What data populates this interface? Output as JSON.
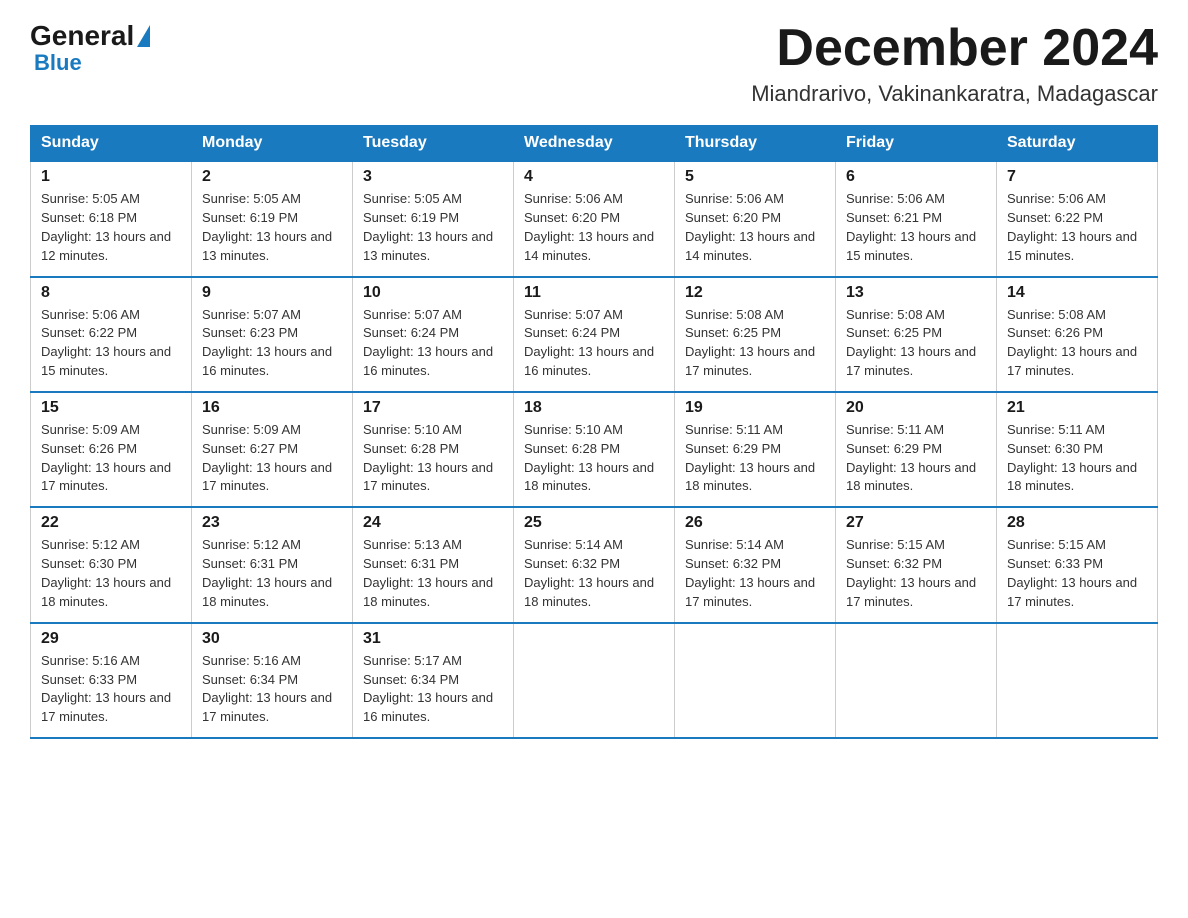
{
  "logo": {
    "general": "General",
    "blue": "Blue"
  },
  "title": "December 2024",
  "location": "Miandrarivo, Vakinankaratra, Madagascar",
  "days_of_week": [
    "Sunday",
    "Monday",
    "Tuesday",
    "Wednesday",
    "Thursday",
    "Friday",
    "Saturday"
  ],
  "weeks": [
    [
      {
        "day": "1",
        "sunrise": "Sunrise: 5:05 AM",
        "sunset": "Sunset: 6:18 PM",
        "daylight": "Daylight: 13 hours and 12 minutes."
      },
      {
        "day": "2",
        "sunrise": "Sunrise: 5:05 AM",
        "sunset": "Sunset: 6:19 PM",
        "daylight": "Daylight: 13 hours and 13 minutes."
      },
      {
        "day": "3",
        "sunrise": "Sunrise: 5:05 AM",
        "sunset": "Sunset: 6:19 PM",
        "daylight": "Daylight: 13 hours and 13 minutes."
      },
      {
        "day": "4",
        "sunrise": "Sunrise: 5:06 AM",
        "sunset": "Sunset: 6:20 PM",
        "daylight": "Daylight: 13 hours and 14 minutes."
      },
      {
        "day": "5",
        "sunrise": "Sunrise: 5:06 AM",
        "sunset": "Sunset: 6:20 PM",
        "daylight": "Daylight: 13 hours and 14 minutes."
      },
      {
        "day": "6",
        "sunrise": "Sunrise: 5:06 AM",
        "sunset": "Sunset: 6:21 PM",
        "daylight": "Daylight: 13 hours and 15 minutes."
      },
      {
        "day": "7",
        "sunrise": "Sunrise: 5:06 AM",
        "sunset": "Sunset: 6:22 PM",
        "daylight": "Daylight: 13 hours and 15 minutes."
      }
    ],
    [
      {
        "day": "8",
        "sunrise": "Sunrise: 5:06 AM",
        "sunset": "Sunset: 6:22 PM",
        "daylight": "Daylight: 13 hours and 15 minutes."
      },
      {
        "day": "9",
        "sunrise": "Sunrise: 5:07 AM",
        "sunset": "Sunset: 6:23 PM",
        "daylight": "Daylight: 13 hours and 16 minutes."
      },
      {
        "day": "10",
        "sunrise": "Sunrise: 5:07 AM",
        "sunset": "Sunset: 6:24 PM",
        "daylight": "Daylight: 13 hours and 16 minutes."
      },
      {
        "day": "11",
        "sunrise": "Sunrise: 5:07 AM",
        "sunset": "Sunset: 6:24 PM",
        "daylight": "Daylight: 13 hours and 16 minutes."
      },
      {
        "day": "12",
        "sunrise": "Sunrise: 5:08 AM",
        "sunset": "Sunset: 6:25 PM",
        "daylight": "Daylight: 13 hours and 17 minutes."
      },
      {
        "day": "13",
        "sunrise": "Sunrise: 5:08 AM",
        "sunset": "Sunset: 6:25 PM",
        "daylight": "Daylight: 13 hours and 17 minutes."
      },
      {
        "day": "14",
        "sunrise": "Sunrise: 5:08 AM",
        "sunset": "Sunset: 6:26 PM",
        "daylight": "Daylight: 13 hours and 17 minutes."
      }
    ],
    [
      {
        "day": "15",
        "sunrise": "Sunrise: 5:09 AM",
        "sunset": "Sunset: 6:26 PM",
        "daylight": "Daylight: 13 hours and 17 minutes."
      },
      {
        "day": "16",
        "sunrise": "Sunrise: 5:09 AM",
        "sunset": "Sunset: 6:27 PM",
        "daylight": "Daylight: 13 hours and 17 minutes."
      },
      {
        "day": "17",
        "sunrise": "Sunrise: 5:10 AM",
        "sunset": "Sunset: 6:28 PM",
        "daylight": "Daylight: 13 hours and 17 minutes."
      },
      {
        "day": "18",
        "sunrise": "Sunrise: 5:10 AM",
        "sunset": "Sunset: 6:28 PM",
        "daylight": "Daylight: 13 hours and 18 minutes."
      },
      {
        "day": "19",
        "sunrise": "Sunrise: 5:11 AM",
        "sunset": "Sunset: 6:29 PM",
        "daylight": "Daylight: 13 hours and 18 minutes."
      },
      {
        "day": "20",
        "sunrise": "Sunrise: 5:11 AM",
        "sunset": "Sunset: 6:29 PM",
        "daylight": "Daylight: 13 hours and 18 minutes."
      },
      {
        "day": "21",
        "sunrise": "Sunrise: 5:11 AM",
        "sunset": "Sunset: 6:30 PM",
        "daylight": "Daylight: 13 hours and 18 minutes."
      }
    ],
    [
      {
        "day": "22",
        "sunrise": "Sunrise: 5:12 AM",
        "sunset": "Sunset: 6:30 PM",
        "daylight": "Daylight: 13 hours and 18 minutes."
      },
      {
        "day": "23",
        "sunrise": "Sunrise: 5:12 AM",
        "sunset": "Sunset: 6:31 PM",
        "daylight": "Daylight: 13 hours and 18 minutes."
      },
      {
        "day": "24",
        "sunrise": "Sunrise: 5:13 AM",
        "sunset": "Sunset: 6:31 PM",
        "daylight": "Daylight: 13 hours and 18 minutes."
      },
      {
        "day": "25",
        "sunrise": "Sunrise: 5:14 AM",
        "sunset": "Sunset: 6:32 PM",
        "daylight": "Daylight: 13 hours and 18 minutes."
      },
      {
        "day": "26",
        "sunrise": "Sunrise: 5:14 AM",
        "sunset": "Sunset: 6:32 PM",
        "daylight": "Daylight: 13 hours and 17 minutes."
      },
      {
        "day": "27",
        "sunrise": "Sunrise: 5:15 AM",
        "sunset": "Sunset: 6:32 PM",
        "daylight": "Daylight: 13 hours and 17 minutes."
      },
      {
        "day": "28",
        "sunrise": "Sunrise: 5:15 AM",
        "sunset": "Sunset: 6:33 PM",
        "daylight": "Daylight: 13 hours and 17 minutes."
      }
    ],
    [
      {
        "day": "29",
        "sunrise": "Sunrise: 5:16 AM",
        "sunset": "Sunset: 6:33 PM",
        "daylight": "Daylight: 13 hours and 17 minutes."
      },
      {
        "day": "30",
        "sunrise": "Sunrise: 5:16 AM",
        "sunset": "Sunset: 6:34 PM",
        "daylight": "Daylight: 13 hours and 17 minutes."
      },
      {
        "day": "31",
        "sunrise": "Sunrise: 5:17 AM",
        "sunset": "Sunset: 6:34 PM",
        "daylight": "Daylight: 13 hours and 16 minutes."
      },
      null,
      null,
      null,
      null
    ]
  ]
}
